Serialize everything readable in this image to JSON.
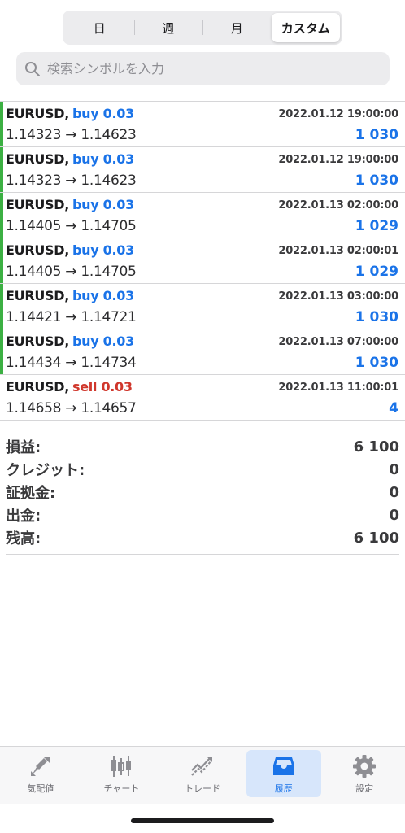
{
  "segments": [
    {
      "label": "日",
      "active": false
    },
    {
      "label": "週",
      "active": false
    },
    {
      "label": "月",
      "active": false
    },
    {
      "label": "カスタム",
      "active": true
    }
  ],
  "search": {
    "placeholder": "検索シンボルを入力",
    "value": ""
  },
  "deals": [
    {
      "symbol": "EURUSD,",
      "side": "buy 0.03",
      "time": "2022.01.12 19:00:00",
      "prices": "1.14323 → 1.14623",
      "profit": "1 030"
    },
    {
      "symbol": "EURUSD,",
      "side": "buy 0.03",
      "time": "2022.01.12 19:00:00",
      "prices": "1.14323 → 1.14623",
      "profit": "1 030"
    },
    {
      "symbol": "EURUSD,",
      "side": "buy 0.03",
      "time": "2022.01.13 02:00:00",
      "prices": "1.14405 → 1.14705",
      "profit": "1 029"
    },
    {
      "symbol": "EURUSD,",
      "side": "buy 0.03",
      "time": "2022.01.13 02:00:01",
      "prices": "1.14405 → 1.14705",
      "profit": "1 029"
    },
    {
      "symbol": "EURUSD,",
      "side": "buy 0.03",
      "time": "2022.01.13 03:00:00",
      "prices": "1.14421 → 1.14721",
      "profit": "1 030"
    },
    {
      "symbol": "EURUSD,",
      "side": "buy 0.03",
      "time": "2022.01.13 07:00:00",
      "prices": "1.14434 → 1.14734",
      "profit": "1 030"
    },
    {
      "symbol": "EURUSD,",
      "side": "sell 0.03",
      "time": "2022.01.13 11:00:01",
      "prices": "1.14658 → 1.14657",
      "profit": "4"
    }
  ],
  "summary": [
    {
      "label": "損益:",
      "value": "6 100"
    },
    {
      "label": "クレジット:",
      "value": "0"
    },
    {
      "label": "証拠金:",
      "value": "0"
    },
    {
      "label": "出金:",
      "value": "0"
    },
    {
      "label": "残高:",
      "value": "6 100"
    }
  ],
  "tabs": [
    {
      "label": "気配値",
      "icon": "quotes-icon",
      "active": false
    },
    {
      "label": "チャート",
      "icon": "chart-icon",
      "active": false
    },
    {
      "label": "トレード",
      "icon": "trade-icon",
      "active": false
    },
    {
      "label": "履歴",
      "icon": "history-icon",
      "active": true
    },
    {
      "label": "設定",
      "icon": "settings-icon",
      "active": false
    }
  ],
  "colors": {
    "buy": "#1a73e8",
    "sell": "#d0372c",
    "buy_bar": "#3cb043",
    "sell_bar": "#ffffff",
    "accent": "#1a73e8"
  }
}
